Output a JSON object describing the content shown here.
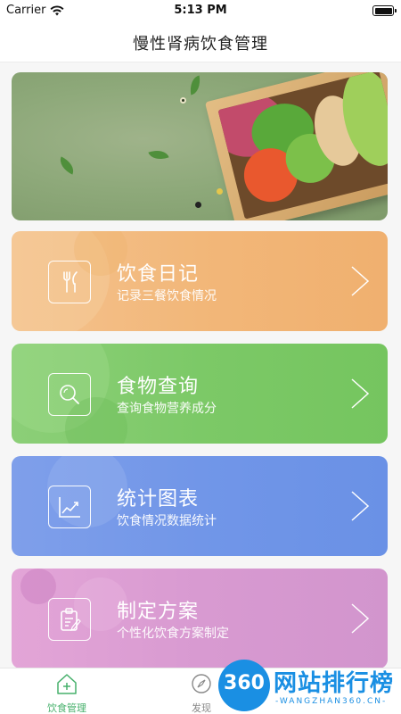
{
  "status_bar": {
    "carrier": "Carrier",
    "time": "5:13 PM"
  },
  "nav": {
    "title": "慢性肾病饮食管理"
  },
  "banner": {
    "icon": "salad-box-image"
  },
  "cards": [
    {
      "title": "饮食日记",
      "subtitle": "记录三餐饮食情况",
      "icon": "fork-knife-icon",
      "color": "#f2b779"
    },
    {
      "title": "食物查询",
      "subtitle": "查询食物营养成分",
      "icon": "search-icon",
      "color": "#7cc967"
    },
    {
      "title": "统计图表",
      "subtitle": "饮食情况数据统计",
      "icon": "chart-icon",
      "color": "#7196e8"
    },
    {
      "title": "制定方案",
      "subtitle": "个性化饮食方案制定",
      "icon": "clipboard-icon",
      "color": "#d89ad1"
    }
  ],
  "tabs": [
    {
      "label": "饮食管理",
      "icon": "home-plus-icon",
      "active": true,
      "color": "#46b06b"
    },
    {
      "label": "发现",
      "icon": "compass-icon",
      "active": false
    }
  ],
  "watermark": {
    "number": "360",
    "text": "网站排行榜",
    "sub": "-WANGZHAN360.CN-"
  }
}
